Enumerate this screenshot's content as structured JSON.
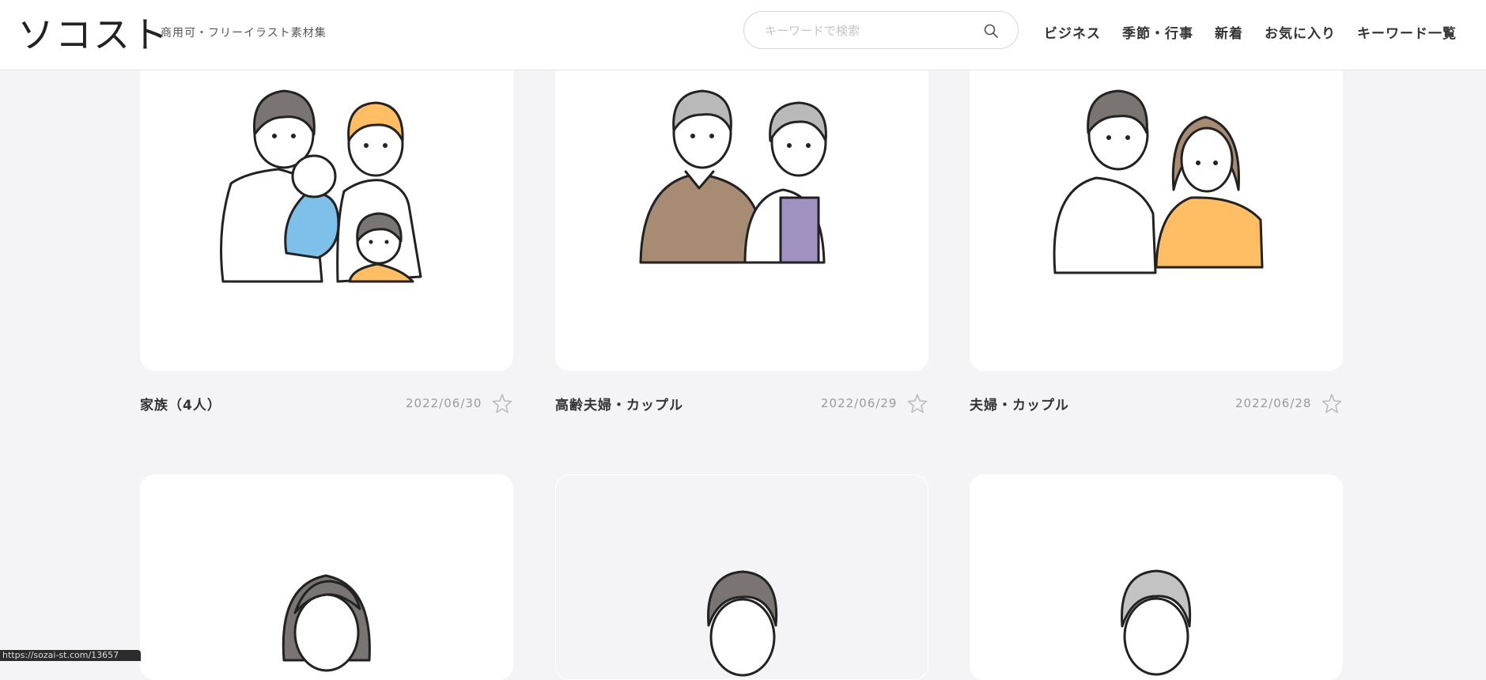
{
  "header": {
    "logo": "ソコスト",
    "tagline": "商用可・フリーイラスト素材集",
    "search_placeholder": "キーワードで検索",
    "search_icon": "search-icon",
    "nav": [
      "ビジネス",
      "季節・行事",
      "新着",
      "お気に入り",
      "キーワード一覧"
    ]
  },
  "cards_row1": [
    {
      "title": "家族（4人）",
      "date": "2022/06/30"
    },
    {
      "title": "高齢夫婦・カップル",
      "date": "2022/06/29"
    },
    {
      "title": "夫婦・カップル",
      "date": "2022/06/28"
    }
  ],
  "favorite_icon": "star-outline-icon",
  "colors": {
    "hair_dark": "#7a7573",
    "hair_grey": "#b9b9b9",
    "orange": "#ffbe64",
    "blue": "#7ec0ea",
    "brown": "#a78b73",
    "purple": "#a093c1",
    "background": "#f4f4f6"
  },
  "statusbar": {
    "text": "https://sozai-st.com/13657"
  }
}
